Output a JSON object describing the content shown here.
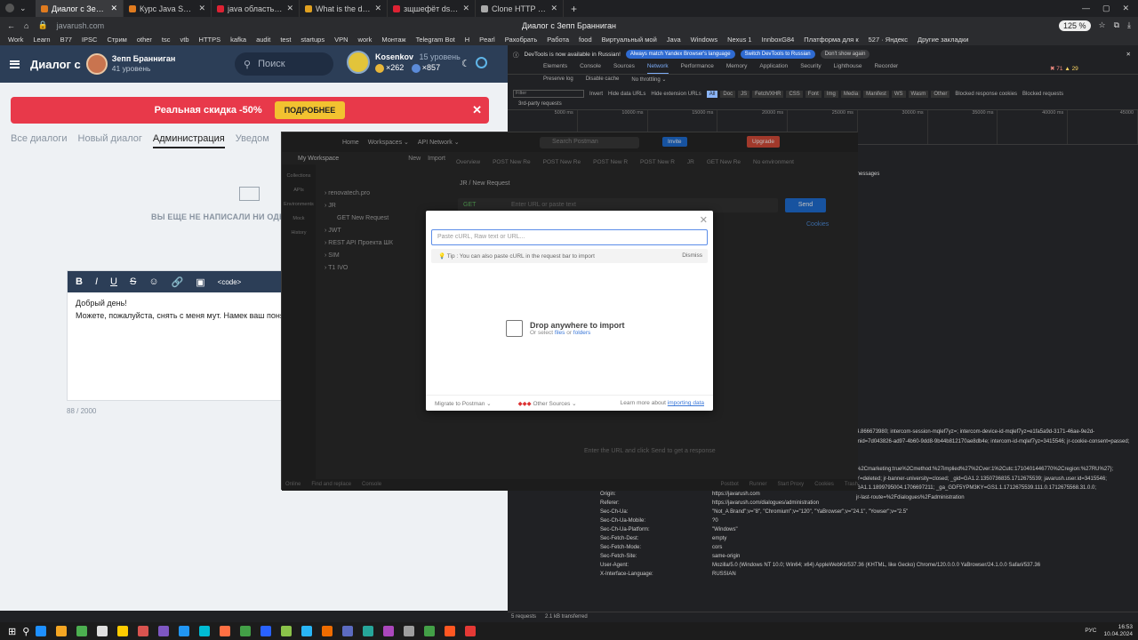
{
  "browser": {
    "tabs": [
      {
        "title": "Диалог с Зепп Бранниган",
        "color": "#e07b1f",
        "active": true
      },
      {
        "title": "Курс Java Syntax Pro - Лек",
        "color": "#e07b1f"
      },
      {
        "title": "java область видимости п",
        "color": "#d23"
      },
      {
        "title": "What is the default access",
        "color": "#e0a020"
      },
      {
        "title": "зщшефёт dsuhepbnm pfgh",
        "color": "#d23"
      },
      {
        "title": "Clone HTTP requests from",
        "color": "#aaa"
      }
    ],
    "url": "javarush.com",
    "center_title": "Диалог с Зепп Бранниган",
    "zoom": "125 %",
    "bookmarks": [
      "Work",
      "Learn",
      "B77",
      "IPSC",
      "Стрим",
      "other",
      "tsc",
      "vtb",
      "HTTPS",
      "kafka",
      "audit",
      "test",
      "startups",
      "VPN",
      "work",
      "Монтаж",
      "Telegram Bot",
      "Н",
      "Pearl",
      "Рахобрать",
      "Работа",
      "food",
      "Виртуальный мой",
      "Java",
      "Windows",
      "Nexus 1",
      "InnboxG84",
      "Платформа для к",
      "527 · Яндекс",
      "Другие закладки"
    ]
  },
  "javarush": {
    "title": "Диалог с",
    "user": {
      "name": "Зепп Бранниган",
      "level": "41 уровень"
    },
    "search_placeholder": "Поиск",
    "me": {
      "name": "Kosenkov",
      "level": "15 уровень",
      "coins": "×262",
      "gems": "×857"
    },
    "promo": {
      "text": "Реальная скидка -50%",
      "button": "ПОДРОБНЕЕ"
    },
    "tabs": [
      "Все диалоги",
      "Новый диалог",
      "Администрация",
      "Уведом"
    ],
    "empty": "ВЫ ЕЩЕ НЕ НАПИСАЛИ НИ ОДНО",
    "editor": {
      "toolbar": [
        "B",
        "I",
        "U",
        "S",
        "☺",
        "🔗",
        "▣",
        "<code>"
      ],
      "lines": [
        "Добрый день!",
        "Можете, пожалуйста, снять с меня мут. Намек ваш понял"
      ],
      "counter": "88 / 2000"
    }
  },
  "postman": {
    "top": [
      "Home",
      "Workspaces ⌄",
      "API Network ⌄"
    ],
    "search": "Search Postman",
    "invite": "Invite",
    "upgrade": "Upgrade",
    "workspace": "My Workspace",
    "new": "New",
    "import": "Import",
    "sidebar": [
      "Collections",
      "APIs",
      "Environments",
      "Mock",
      "History"
    ],
    "tree": [
      "renovatech.pro",
      "JR",
      "GET  New Request",
      "JWT",
      "REST API Проекта ШК",
      "SIM",
      "T1 IVO"
    ],
    "tabs": [
      "Overview",
      "POST New Re",
      "POST New Re",
      "POST New R",
      "POST New R",
      "JR",
      "GET New Re"
    ],
    "env": "No environment",
    "request_name": "JR / New Request",
    "method": "GET",
    "url_placeholder": "Enter URL or paste text",
    "send": "Send",
    "cookies": "Cookies",
    "hint": "Enter the URL and click Send to get a response",
    "bottom": [
      "Online",
      "Find and replace",
      "Console",
      "Postbot",
      "Runner",
      "Start Proxy",
      "Cookies",
      "Trash"
    ]
  },
  "modal": {
    "placeholder": "Paste cURL, Raw text or URL...",
    "tip": "Tip : You can also paste cURL in the request bar to import",
    "dismiss": "Dismiss",
    "drop_title": "Drop anywhere to import",
    "drop_sub_prefix": "Or select",
    "files": "files",
    "or": "or",
    "folders": "folders",
    "migrate": "Migrate to Postman ⌄",
    "other_sources": "Other Sources ⌄",
    "learn_prefix": "Learn more about",
    "learn_link": "importing data"
  },
  "devtools": {
    "note": "DevTools is now available in Russian!",
    "pill1": "Always match Yandex Browser's language",
    "pill2": "Switch DevTools to Russian",
    "pill3": "Don't show again",
    "tabs": [
      "Elements",
      "Console",
      "Sources",
      "Network",
      "Performance",
      "Memory",
      "Application",
      "Security",
      "Lighthouse",
      "Recorder"
    ],
    "active_tab": "Network",
    "errors": "71",
    "warnings": "29",
    "controls": [
      "Preserve log",
      "Disable cache",
      "No throttling ⌄"
    ],
    "filter_label": "Filter",
    "filter_opts": [
      "Invert",
      "Hide data URLs",
      "Hide extension URLs"
    ],
    "types": [
      "All",
      "Doc",
      "JS",
      "Fetch/XHR",
      "CSS",
      "Font",
      "Img",
      "Media",
      "Manifest",
      "WS",
      "Wasm",
      "Other"
    ],
    "blocked": [
      "Blocked response cookies",
      "Blocked requests"
    ],
    "third_party": "3rd-party requests",
    "timeline": [
      "5000 ms",
      "10000 ms",
      "15000 ms",
      "20000 ms",
      "25000 ms",
      "30000 ms",
      "35000 ms",
      "40000 ms",
      "45000"
    ],
    "messages": "messages",
    "cookie_lines": [
      "4.866673980; intercom-session-mqlef7yz=; intercom-device-id-mqlef7yz=e1fa5a9d-3171-46ae-9e2d-",
      "mid=7d043826-ad97-4b60-9dd8-9b44b812170ae8db4e; intercom-id-mqlef7yz=3415546; jr-cookie-consent=passed;",
      "",
      "",
      "%2Cmarketing:true%2Cmethod:%27implied%27%2Cver:1%2Cutc:1710401446770%2Cregion:%27RU%27};",
      "Y=deleted; jr-banner-university=closed; _gid=GA1.2.1350736835.1712675539; javarush.user.id=3415546;",
      "GA1.1.1899795004.1706697211; _ga_GDF5YPM3KY=GS1.1.1712675539.111.0.1712675568.31.0.0;",
      "jr-last-route=%2Fdialogues%2Fadministration"
    ],
    "headers": [
      [
        "Origin:",
        "https://javarush.com"
      ],
      [
        "Referer:",
        "https://javarush.com/dialogues/administration"
      ],
      [
        "Sec-Ch-Ua:",
        "\"Not_A Brand\";v=\"8\", \"Chromium\";v=\"120\", \"YaBrowser\";v=\"24.1\", \"Yowser\";v=\"2.5\""
      ],
      [
        "Sec-Ch-Ua-Mobile:",
        "?0"
      ],
      [
        "Sec-Ch-Ua-Platform:",
        "\"Windows\""
      ],
      [
        "Sec-Fetch-Dest:",
        "empty"
      ],
      [
        "Sec-Fetch-Mode:",
        "cors"
      ],
      [
        "Sec-Fetch-Site:",
        "same-origin"
      ],
      [
        "User-Agent:",
        "Mozilla/5.0 (Windows NT 10.0; Win64; x64) AppleWebKit/537.36 (KHTML, like Gecko) Chrome/120.0.0.0 YaBrowser/24.1.0.0 Safari/537.36"
      ],
      [
        "X-Interface-Language:",
        "RUSSIAN"
      ]
    ],
    "status_requests": "5 requests",
    "status_transferred": "2.1 kB transferred"
  },
  "taskbar": {
    "apps": [
      "#1e90ff",
      "#f5a623",
      "#4caf50",
      "#e0e0e0",
      "#ffcc00",
      "#d9534f",
      "#7e57c2",
      "#2196f3",
      "#00bcd4",
      "#ff7043",
      "#43a047",
      "#2962ff",
      "#8bc34a",
      "#29b6f6",
      "#ef6c00",
      "#5c6bc0",
      "#26a69a",
      "#ab47bc",
      "#9e9e9e",
      "#43a047",
      "#ff5722",
      "#e53935"
    ],
    "lang": "РУС",
    "time": "16:53",
    "date": "10.04.2024"
  }
}
